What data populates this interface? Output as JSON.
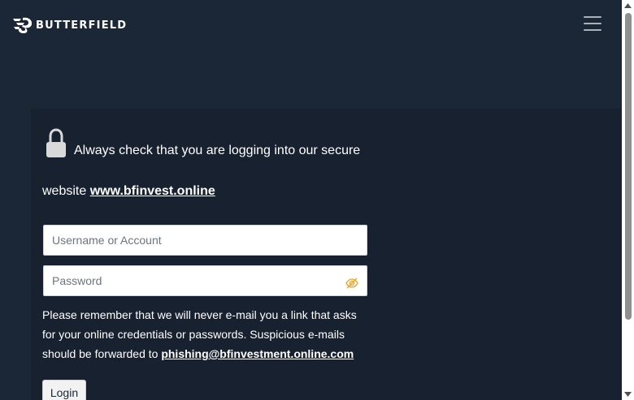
{
  "header": {
    "brand": "BUTTERFIELD",
    "logo_icon": "butterfield-logo-icon",
    "menu_icon": "hamburger-menu-icon"
  },
  "notice": {
    "lock_icon": "lock-icon",
    "text": "Always check that you are logging into our secure website ",
    "link": "www.bfinvest.online"
  },
  "form": {
    "username_placeholder": "Username or Account",
    "password_placeholder": "Password",
    "eye_icon": "eye-slash-icon",
    "login_label": "Login"
  },
  "policy": {
    "text": "Please remember that we will never e-mail you a link that asks for your online credentials or passwords. Suspicious e-mails should be forwarded to ",
    "email": "phishing@bfinvestment.online.com"
  },
  "colors": {
    "background": "#1b2636",
    "card": "#182130",
    "text": "#ffffff"
  }
}
